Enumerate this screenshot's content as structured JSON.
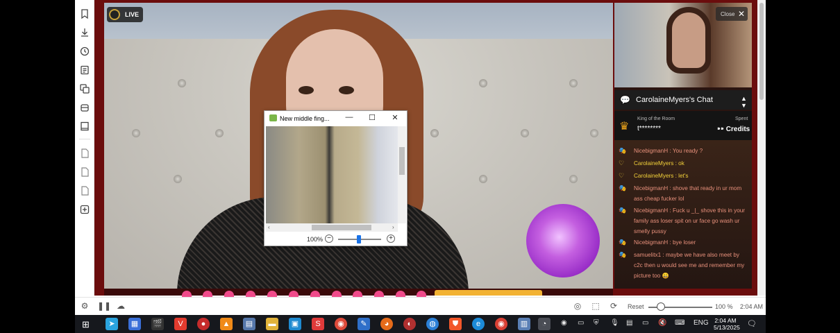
{
  "stream": {
    "live_badge": "LIVE",
    "close_label": "Close"
  },
  "chat": {
    "title": "CarolaineMyers's Chat",
    "king_label": "King of the Room",
    "king_name": "t********",
    "spent_label": "Spent",
    "credits_label": "Credits",
    "messages": [
      {
        "user": "NicebigmanH",
        "text": "NicebigmanH : You ready ?",
        "color": "salmon"
      },
      {
        "user": "CarolaineMyers",
        "text": "CarolaineMyers : ok",
        "color": "gold"
      },
      {
        "user": "CarolaineMyers",
        "text": "CarolaineMyers : let's",
        "color": "gold"
      },
      {
        "user": "NicebigmanH",
        "text": "NicebigmanH : shove that ready in ur mom ass cheap fucker lol",
        "color": "salmon"
      },
      {
        "user": "NicebigmanH",
        "text": "NicebigmanH : Fuck u _|_ shove this in your family ass loser spit on ur face go wash ur smelly pussy",
        "color": "salmon"
      },
      {
        "user": "NicebigmanH",
        "text": "NicebigmanH : bye loser",
        "color": "salmon"
      },
      {
        "user": "samuelitx1",
        "text": "samuelitx1 : maybe we have also meet by c2c then u would see me and remember my picture too 😀",
        "color": "salmon"
      }
    ]
  },
  "viewer": {
    "title": "New middle fing...",
    "zoom": "100%"
  },
  "statusbar": {
    "reset_label": "Reset",
    "zoom": "100 %",
    "time": "2:04 AM"
  },
  "taskbar": {
    "language": "ENG",
    "time": "2:04 AM",
    "date": "5/13/2025"
  },
  "colors": {
    "frame": "#6b0d0d",
    "chat_name_gold": "#f4d23a",
    "chat_name_salmon": "#e9917c",
    "accent_blue": "#1a73e8"
  }
}
